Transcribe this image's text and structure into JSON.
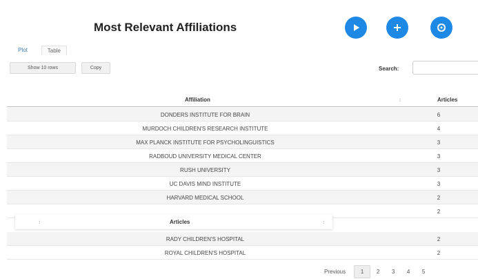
{
  "page": {
    "title": "Most Relevant Affiliations"
  },
  "actions": [
    {
      "icon": "play-icon"
    },
    {
      "icon": "plus-icon"
    },
    {
      "icon": "settings-icon"
    }
  ],
  "tabs": [
    {
      "label": "Plot"
    },
    {
      "label": "Table"
    }
  ],
  "toolbar": {
    "show_entries_label": "Show 10 rows",
    "copy_label": "Copy",
    "search_label": "Search:",
    "search_value": ""
  },
  "table": {
    "columns": [
      "Affiliation",
      "Articles"
    ],
    "rows": [
      {
        "affiliation": "DONDERS INSTITUTE FOR BRAIN",
        "articles": "6"
      },
      {
        "affiliation": "MURDOCH CHILDREN'S RESEARCH INSTITUTE",
        "articles": "4"
      },
      {
        "affiliation": "MAX PLANCK INSTITUTE FOR PSYCHOLINGUISTICS",
        "articles": "3"
      },
      {
        "affiliation": "RADBOUD UNIVERSITY MEDICAL CENTER",
        "articles": "3"
      },
      {
        "affiliation": "RUSH UNIVERSITY",
        "articles": "3"
      },
      {
        "affiliation": "UC DAVIS MIND INSTITUTE",
        "articles": "3"
      },
      {
        "affiliation": "HARVARD MEDICAL SCHOOL",
        "articles": "2"
      },
      {
        "affiliation": "",
        "articles": "2"
      },
      {
        "affiliation": "RADY CHILDREN'S HOSPITAL",
        "articles": "2"
      },
      {
        "affiliation": "ROYAL CHILDREN'S HOSPITAL",
        "articles": "2"
      }
    ],
    "sticky_header_label": "Articles"
  },
  "pagination": {
    "previous_label": "Previous",
    "pages": [
      "1",
      "2",
      "3",
      "4",
      "5"
    ],
    "current_page": "1"
  },
  "colors": {
    "accent": "#1e88e5",
    "row_stripe": "#f4f4f4"
  }
}
